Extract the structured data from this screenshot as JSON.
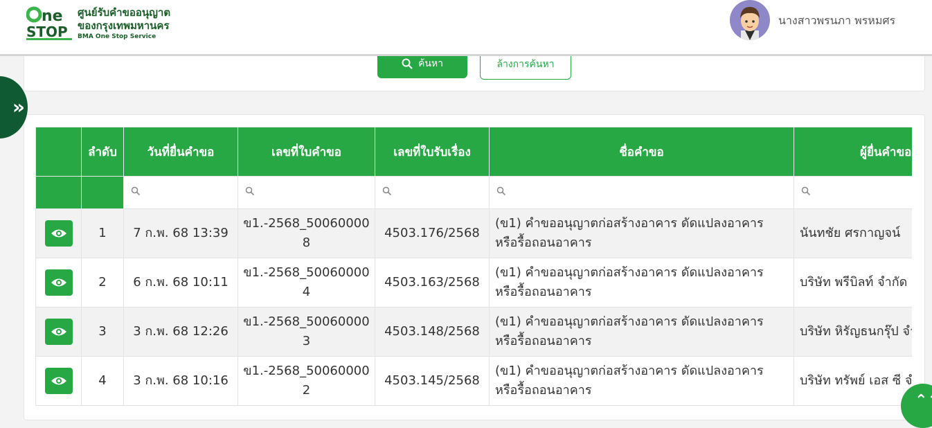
{
  "header": {
    "logo_line1": "ศูนย์รับคำขออนุญาต",
    "logo_line2": "ของกรุงเทพมหานคร",
    "logo_line3": "BMA One Stop Service",
    "logo_mark_top": "one",
    "logo_mark_bottom": "STOP",
    "user_name": "นางสาวพรนภา พรหมศร"
  },
  "search": {
    "search_label": "ค้นหา",
    "clear_label": "ล้างการค้นหา"
  },
  "icons": {
    "sidebar_toggle": "»",
    "scroll_top": "⌃⌃"
  },
  "colors": {
    "brand_green": "#28a745",
    "dark_green": "#0f5a32"
  },
  "table": {
    "columns": [
      "",
      "ลำดับ",
      "วันที่ยื่นคำขอ",
      "เลขที่ใบคำขอ",
      "เลขที่ใบรับเรื่อง",
      "ชื่อคำขอ",
      "ผู้ยื่นคำขอ"
    ],
    "rows": [
      {
        "no": "1",
        "date": "7 ก.พ. 68 13:39",
        "request_no": "ข1.-2568_500600008",
        "receipt_no": "4503.176/2568",
        "name": "(ข1) คำขออนุญาตก่อสร้างอาคาร ดัดแปลงอาคาร หรือรื้อถอนอาคาร",
        "applicant": "นันทชัย ศรกาญจน์"
      },
      {
        "no": "2",
        "date": "6 ก.พ. 68 10:11",
        "request_no": "ข1.-2568_500600004",
        "receipt_no": "4503.163/2568",
        "name": "(ข1) คำขออนุญาตก่อสร้างอาคาร ดัดแปลงอาคาร หรือรื้อถอนอาคาร",
        "applicant": "บริษัท พรีบิลท์ จำกัด (มหาชน)"
      },
      {
        "no": "3",
        "date": "3 ก.พ. 68 12:26",
        "request_no": "ข1.-2568_500600003",
        "receipt_no": "4503.148/2568",
        "name": "(ข1) คำขออนุญาตก่อสร้างอาคาร ดัดแปลงอาคาร หรือรื้อถอนอาคาร",
        "applicant": "บริษัท หิรัญธนกรุ๊ป จำกัด"
      },
      {
        "no": "4",
        "date": "3 ก.พ. 68 10:16",
        "request_no": "ข1.-2568_500600002",
        "receipt_no": "4503.145/2568",
        "name": "(ข1) คำขออนุญาตก่อสร้างอาคาร ดัดแปลงอาคาร หรือรื้อถอนอาคาร",
        "applicant": "บริษัท ทรัพย์ เอส ซี จำกัด"
      }
    ]
  }
}
